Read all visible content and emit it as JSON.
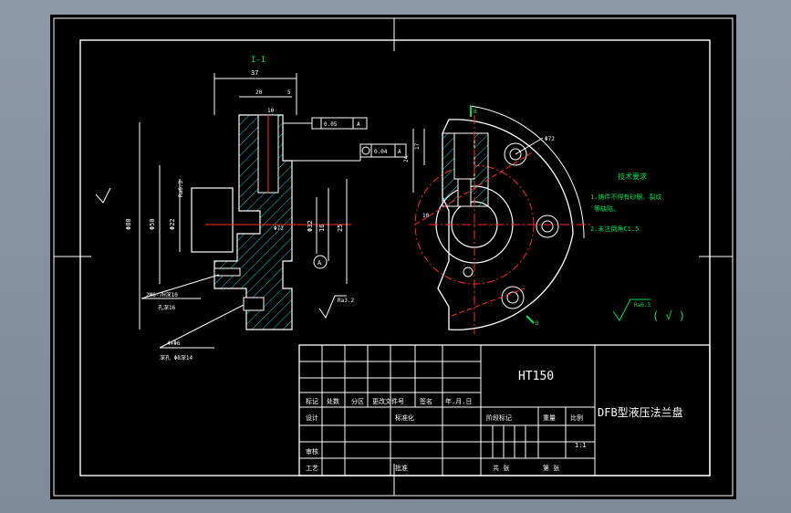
{
  "drawing": {
    "section_label": "I-I",
    "material": "HT150",
    "part_name": "DFB型液压法兰盘",
    "tech_title": "技术要求",
    "tech_notes": [
      "1.铸件不得有砂眼、裂纹",
      "等缺陷。",
      "2.未注倒角C1.5"
    ],
    "roughness_general": "Ra6.3",
    "roughness_paren": "( √ )",
    "dim_labels": {
      "top_width": "37",
      "top_sub": "20",
      "top_sub2": "5",
      "slot": "10",
      "tol1": "0.05",
      "tol1_ref": "A",
      "tol2": "0.04",
      "tol2_ref": "A",
      "dia_left": "Φ80",
      "dia_inner": "Φ50",
      "dia_bore": "Φ22",
      "dia_small": "Φ32",
      "height_a": "16",
      "height_b": "25",
      "dia_right": "Φ72",
      "right_h1": "17",
      "right_h2": "24",
      "right_w": "10",
      "ra_face": "Ra3.2",
      "note_thread1": "2M6-7H深10",
      "note_thread2": "孔深16",
      "note_hole1": "4×Φ6",
      "note_hole2": "深孔 Φ8深14",
      "datum": "A",
      "view_mark": "B",
      "view_mark2": "B",
      "roughness_small": "Ra6.3"
    }
  },
  "title_block": {
    "row_labels": [
      "标记",
      "处数",
      "分区",
      "更改文件号",
      "签名",
      "年.月.日"
    ],
    "design": "设计",
    "standard": "标准化",
    "review": "审核",
    "process": "工艺",
    "approve": "批准",
    "stage_mark": "阶段标记",
    "weight": "重量",
    "scale": "比例",
    "scale_value": "1:1",
    "sheet_total": "共 张",
    "sheet_no": "第 张"
  },
  "colors": {
    "line": "#ffffff",
    "hatch": "#00e5e5",
    "accent": "#ff2a2a",
    "annotation": "#00e05a",
    "viewport_bg": "#000000"
  }
}
